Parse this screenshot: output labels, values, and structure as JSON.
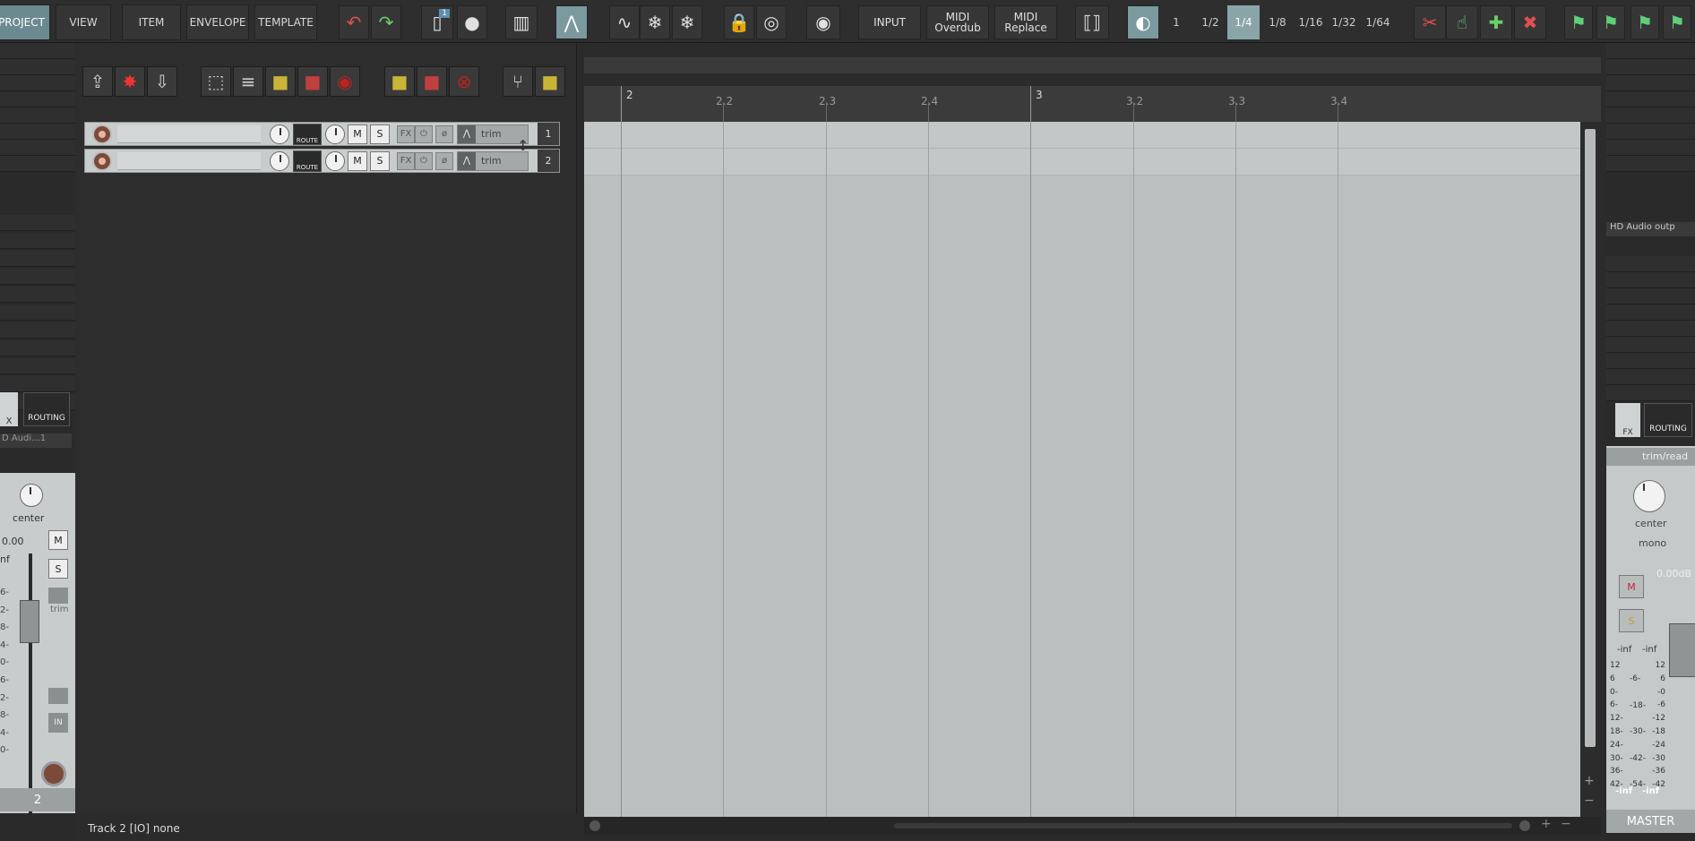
{
  "toolbar": {
    "tabs": [
      {
        "label": "PROJECT",
        "active": true
      },
      {
        "label": "VIEW",
        "active": false
      },
      {
        "label": "ITEM",
        "active": false
      },
      {
        "label": "ENVELOPE",
        "active": false
      },
      {
        "label": "TEMPLATE",
        "active": false
      }
    ],
    "input_label": "INPUT",
    "midi_overdub": [
      "MIDI",
      "Overdub"
    ],
    "midi_replace": [
      "MIDI",
      "Replace"
    ],
    "grid_divisions": [
      "1",
      "1/2",
      "1/4",
      "1/8",
      "1/16",
      "1/32",
      "1/64"
    ],
    "grid_selected": "1/4",
    "badge_count": "1"
  },
  "tracks": [
    {
      "number": "1",
      "trim_label": "trim",
      "route_label": "ROUTE",
      "mute_label": "M",
      "solo_label": "S",
      "fx_label": "FX"
    },
    {
      "number": "2",
      "trim_label": "trim",
      "route_label": "ROUTE",
      "mute_label": "M",
      "solo_label": "S",
      "fx_label": "FX"
    }
  ],
  "ruler": {
    "marks": [
      {
        "label": "2",
        "bar": true
      },
      {
        "label": "2.2",
        "bar": false
      },
      {
        "label": "2.3",
        "bar": false
      },
      {
        "label": "2.4",
        "bar": false
      },
      {
        "label": "3",
        "bar": true
      },
      {
        "label": "3.2",
        "bar": false
      },
      {
        "label": "3.3",
        "bar": false
      },
      {
        "label": "3.4",
        "bar": false
      }
    ]
  },
  "status_bar": {
    "text": "Track 2 [IO] none"
  },
  "left_mixer": {
    "fx_label": "X",
    "routing_label": "ROUTING",
    "io_label": "D Audi...1",
    "pan_label": "center",
    "volume": "0.00",
    "inf_label": "nf",
    "mute_label": "M",
    "solo_label": "S",
    "trim_label": "trim",
    "track_number": "2",
    "in_label": "IN",
    "meter_scale": [
      "6-",
      "2-",
      "8-",
      "4-",
      "0-",
      "6-",
      "2-",
      "8-",
      "4-",
      "0-"
    ]
  },
  "master": {
    "output_label": "HD Audio outp",
    "fx_label": "FX",
    "routing_label": "ROUTING",
    "automation_label": "trim/read",
    "pan_label": "center",
    "mono_label": "mono",
    "volume": "0.00dB",
    "mute_label": "M",
    "solo_label": "S",
    "inf_left": "-inf",
    "inf_right": "-inf",
    "bottom_inf_left": "-inf",
    "bottom_inf_right": "-inf",
    "scale_left": [
      "12",
      "6",
      "0-",
      "6-",
      "12-",
      "18-",
      "24-",
      "30-",
      "36-",
      "42-"
    ],
    "scale_mid": [
      "-6-",
      "-18-",
      "-30-",
      "-42-",
      "-54-"
    ],
    "scale_right": [
      "12",
      "6",
      "-0",
      "-6",
      "-12",
      "-18",
      "-24",
      "-30",
      "-36",
      "-42"
    ],
    "label": "MASTER"
  },
  "colors": {
    "accent": "#6b8a8f",
    "lane": "#c4c7c7",
    "background": "#2b2b2b"
  }
}
